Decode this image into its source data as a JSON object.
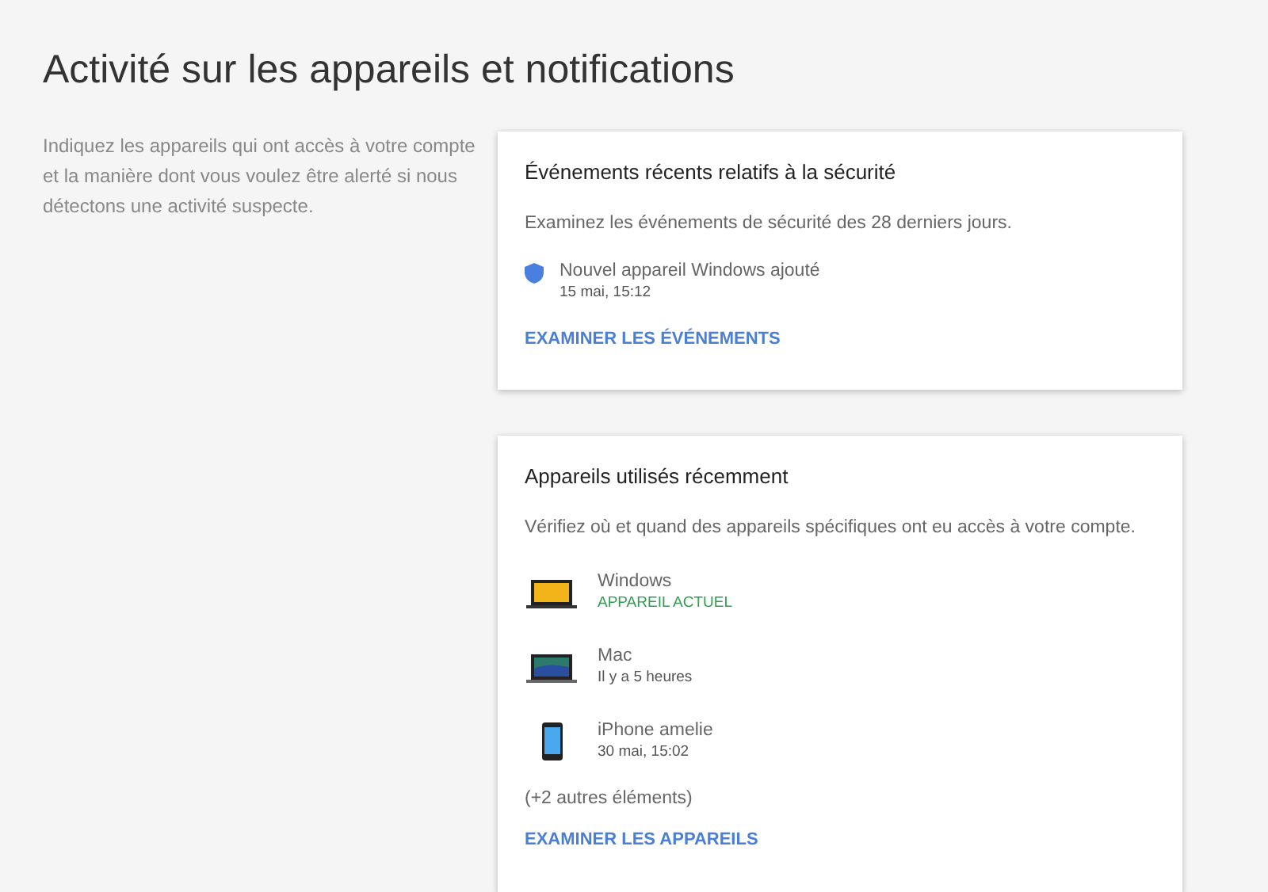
{
  "title": "Activité sur les appareils et notifications",
  "description": "Indiquez les appareils qui ont accès à votre compte et la manière dont vous voulez être alerté si nous détectons une activité suspecte.",
  "security_card": {
    "title": "Événements récents relatifs à la sécurité",
    "subtitle": "Examinez les événements de sécurité des 28 derniers jours.",
    "events": [
      {
        "name": "Nouvel appareil Windows ajouté",
        "time": "15 mai, 15:12"
      }
    ],
    "link": "EXAMINER LES ÉVÉNEMENTS"
  },
  "devices_card": {
    "title": "Appareils utilisés récemment",
    "subtitle": "Vérifiez où et quand des appareils spécifiques ont eu accès à votre compte.",
    "devices": [
      {
        "kind": "windows",
        "name": "Windows",
        "detail": "APPAREIL ACTUEL",
        "current": true
      },
      {
        "kind": "mac",
        "name": "Mac",
        "detail": "Il y a 5 heures",
        "current": false
      },
      {
        "kind": "phone",
        "name": "iPhone amelie",
        "detail": "30 mai, 15:02",
        "current": false
      }
    ],
    "more": "(+2 autres éléments)",
    "link": "EXAMINER LES APPAREILS"
  }
}
